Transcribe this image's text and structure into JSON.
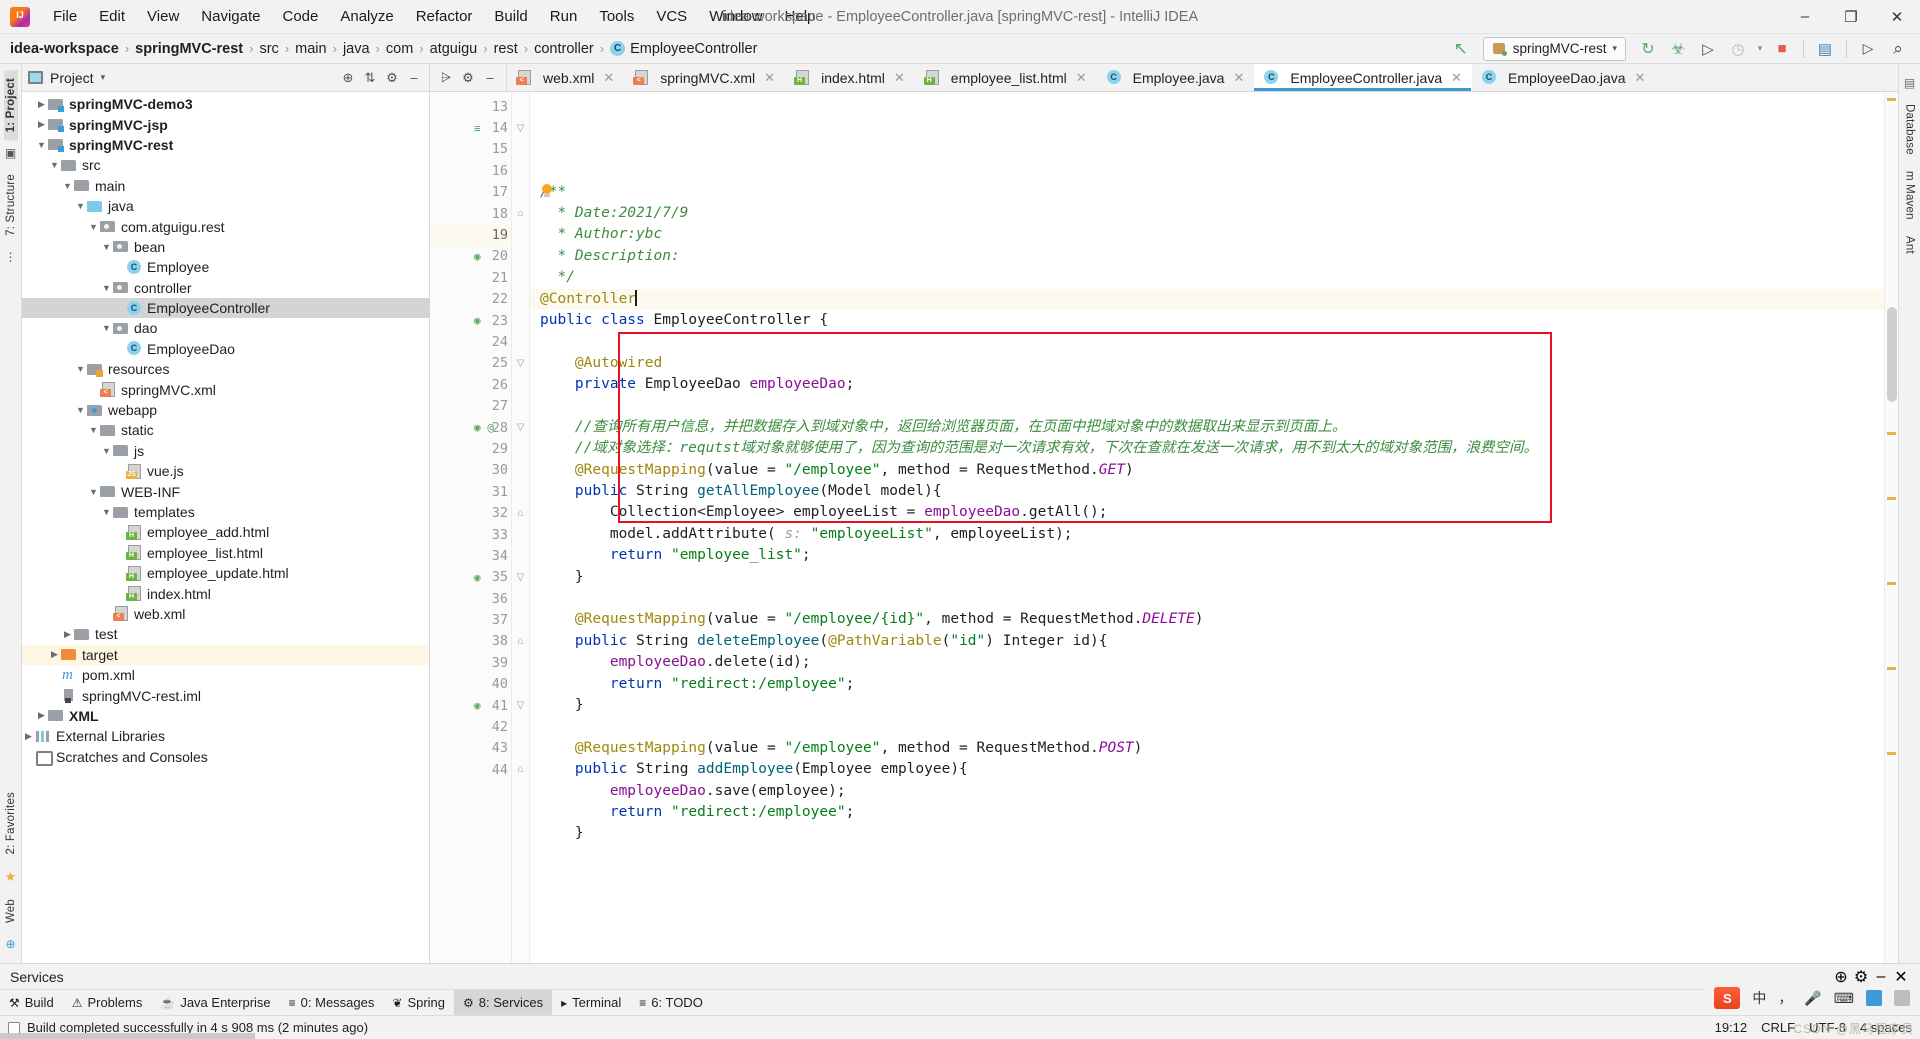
{
  "window": {
    "title": "idea-workspace - EmployeeController.java [springMVC-rest] - IntelliJ IDEA",
    "minimize": "–",
    "maximize": "❐",
    "close": "✕"
  },
  "menu": {
    "items": [
      "File",
      "Edit",
      "View",
      "Navigate",
      "Code",
      "Analyze",
      "Refactor",
      "Build",
      "Run",
      "Tools",
      "VCS",
      "Window",
      "Help"
    ]
  },
  "breadcrumb": {
    "items": [
      "idea-workspace",
      "springMVC-rest",
      "src",
      "main",
      "java",
      "com",
      "atguigu",
      "rest",
      "controller"
    ],
    "class_item": "EmployeeController",
    "separator": "›"
  },
  "toolbar": {
    "build_hammer": "↖",
    "run_config": "springMVC-rest",
    "run_config_caret": "▾",
    "rerun": "↻",
    "debug": "☣",
    "coverage": "▷",
    "profile": "◷",
    "profile_caret": "▾",
    "stop": "■",
    "project_structure": "▤",
    "device_manager": "▷",
    "search_everywhere": "⌕"
  },
  "project_panel": {
    "title": "Project",
    "caret": "▾",
    "actions": [
      "⊕",
      "⇅",
      "⚙",
      "–"
    ],
    "tree": [
      {
        "label": "springMVC-demo3",
        "depth": 1,
        "twisty": "▶",
        "icon": "mod",
        "bold": true
      },
      {
        "label": "springMVC-jsp",
        "depth": 1,
        "twisty": "▶",
        "icon": "mod",
        "bold": true
      },
      {
        "label": "springMVC-rest",
        "depth": 1,
        "twisty": "▼",
        "icon": "mod",
        "bold": true
      },
      {
        "label": "src",
        "depth": 2,
        "twisty": "▼",
        "icon": "fold",
        "bold": false
      },
      {
        "label": "main",
        "depth": 3,
        "twisty": "▼",
        "icon": "fold",
        "bold": false
      },
      {
        "label": "java",
        "depth": 4,
        "twisty": "▼",
        "icon": "src",
        "bold": false
      },
      {
        "label": "com.atguigu.rest",
        "depth": 5,
        "twisty": "▼",
        "icon": "pkg",
        "bold": false
      },
      {
        "label": "bean",
        "depth": 6,
        "twisty": "▼",
        "icon": "pkg",
        "bold": false
      },
      {
        "label": "Employee",
        "depth": 7,
        "twisty": "",
        "icon": "cls",
        "bold": false
      },
      {
        "label": "controller",
        "depth": 6,
        "twisty": "▼",
        "icon": "pkg",
        "bold": false
      },
      {
        "label": "EmployeeController",
        "depth": 7,
        "twisty": "",
        "icon": "cls",
        "bold": false,
        "selected": true
      },
      {
        "label": "dao",
        "depth": 6,
        "twisty": "▼",
        "icon": "pkg",
        "bold": false
      },
      {
        "label": "EmployeeDao",
        "depth": 7,
        "twisty": "",
        "icon": "cls",
        "bold": false
      },
      {
        "label": "resources",
        "depth": 4,
        "twisty": "▼",
        "icon": "res",
        "bold": false
      },
      {
        "label": "springMVC.xml",
        "depth": 5,
        "twisty": "",
        "icon": "xml",
        "bold": false
      },
      {
        "label": "webapp",
        "depth": 4,
        "twisty": "▼",
        "icon": "web",
        "bold": false
      },
      {
        "label": "static",
        "depth": 5,
        "twisty": "▼",
        "icon": "fold",
        "bold": false
      },
      {
        "label": "js",
        "depth": 6,
        "twisty": "▼",
        "icon": "fold",
        "bold": false
      },
      {
        "label": "vue.js",
        "depth": 7,
        "twisty": "",
        "icon": "js",
        "bold": false
      },
      {
        "label": "WEB-INF",
        "depth": 5,
        "twisty": "▼",
        "icon": "fold",
        "bold": false
      },
      {
        "label": "templates",
        "depth": 6,
        "twisty": "▼",
        "icon": "fold",
        "bold": false
      },
      {
        "label": "employee_add.html",
        "depth": 7,
        "twisty": "",
        "icon": "html",
        "bold": false
      },
      {
        "label": "employee_list.html",
        "depth": 7,
        "twisty": "",
        "icon": "html",
        "bold": false
      },
      {
        "label": "employee_update.html",
        "depth": 7,
        "twisty": "",
        "icon": "html",
        "bold": false
      },
      {
        "label": "index.html",
        "depth": 7,
        "twisty": "",
        "icon": "html",
        "bold": false
      },
      {
        "label": "web.xml",
        "depth": 6,
        "twisty": "",
        "icon": "xml",
        "bold": false
      },
      {
        "label": "test",
        "depth": 3,
        "twisty": "▶",
        "icon": "fold",
        "bold": false
      },
      {
        "label": "target",
        "depth": 2,
        "twisty": "▶",
        "icon": "tgt",
        "bold": false,
        "highlight": true
      },
      {
        "label": "pom.xml",
        "depth": 2,
        "twisty": "",
        "icon": "maven",
        "bold": false
      },
      {
        "label": "springMVC-rest.iml",
        "depth": 2,
        "twisty": "",
        "icon": "iml",
        "bold": false
      },
      {
        "label": "XML",
        "depth": 1,
        "twisty": "▶",
        "icon": "xmlgrp",
        "bold": true
      },
      {
        "label": "External Libraries",
        "depth": 0,
        "twisty": "▶",
        "icon": "lib",
        "bold": false
      },
      {
        "label": "Scratches and Consoles",
        "depth": 0,
        "twisty": "",
        "icon": "scratch",
        "bold": false
      }
    ]
  },
  "left_rail": {
    "tabs": [
      "1: Project",
      "7: Structure"
    ],
    "bottom_tabs": [
      "2: Favorites",
      "Web"
    ]
  },
  "right_rail": {
    "tabs": [
      "Database",
      "m Maven",
      "Ant"
    ]
  },
  "editor_tabs": [
    {
      "label": "web.xml",
      "icon": "xml",
      "active": false,
      "close": "✕"
    },
    {
      "label": "springMVC.xml",
      "icon": "xml",
      "active": false,
      "close": "✕"
    },
    {
      "label": "index.html",
      "icon": "html",
      "active": false,
      "close": "✕"
    },
    {
      "label": "employee_list.html",
      "icon": "html",
      "active": false,
      "close": "✕"
    },
    {
      "label": "Employee.java",
      "icon": "java",
      "active": false,
      "close": "✕"
    },
    {
      "label": "EmployeeController.java",
      "icon": "java",
      "active": true,
      "close": "✕"
    },
    {
      "label": "EmployeeDao.java",
      "icon": "java",
      "active": false,
      "close": "✕"
    }
  ],
  "editor_tab_actions": {
    "collapse": "⩥",
    "settings": "⚙",
    "hide": "–"
  },
  "code": {
    "first_line": 13,
    "current_line": 19,
    "lines": [
      {
        "n": 13,
        "html": ""
      },
      {
        "n": 14,
        "html": "<span class='doc'>/**</span>",
        "mark": "≡",
        "fold": "▽"
      },
      {
        "n": 15,
        "html": "  <span class='doc'>* Date:2021/7/9</span>"
      },
      {
        "n": 16,
        "html": "  <span class='doc'>* Author:ybc</span>"
      },
      {
        "n": 17,
        "html": "  <span class='doc'>* Description:</span>"
      },
      {
        "n": 18,
        "html": "  <span class='doc'>*/</span>",
        "fold": "⌂",
        "bulb": true
      },
      {
        "n": 19,
        "html": "<span class='ann'>@Controller</span><span class='caret-bar'></span>",
        "current": true
      },
      {
        "n": 20,
        "html": "<span class='kw'>public class</span> EmployeeController {",
        "mark": "◉"
      },
      {
        "n": 21,
        "html": ""
      },
      {
        "n": 22,
        "html": "    <span class='ann'>@Autowired</span>"
      },
      {
        "n": 23,
        "html": "    <span class='kw'>private</span> EmployeeDao <span class='fld'>employeeDao</span>;",
        "mark": "◉"
      },
      {
        "n": 24,
        "html": ""
      },
      {
        "n": 25,
        "html": "    <span class='cmt-zh'>//查询所有用户信息，并把数据存入到域对象中，返回给浏览器页面，在页面中把域对象中的数据取出来显示到页面上。</span>",
        "fold": "▽"
      },
      {
        "n": 26,
        "html": "    <span class='cmt-zh'>//域对象选择：requtst域对象就够使用了，因为查询的范围是对一次请求有效，下次在查就在发送一次请求，用不到太大的域对象范围，浪费空间。</span>"
      },
      {
        "n": 27,
        "html": "    <span class='ann'>@RequestMapping</span>(value = <span class='str'>\"/employee\"</span>, method = RequestMethod.<span class='sta'>GET</span>)"
      },
      {
        "n": 28,
        "html": "    <span class='kw'>public</span> String <span class='mth'>getAllEmployee</span>(Model model){",
        "mark": "◉ @",
        "fold": "▽"
      },
      {
        "n": 29,
        "html": "        Collection&lt;Employee&gt; employeeList = <span class='fld'>employeeDao</span>.getAll();"
      },
      {
        "n": 30,
        "html": "        model.addAttribute( <span class='param-hint'>s:</span> <span class='str'>\"employeeList\"</span>, employeeList);"
      },
      {
        "n": 31,
        "html": "        <span class='kw'>return</span> <span class='str'>\"employee_list\"</span>;"
      },
      {
        "n": 32,
        "html": "    }",
        "fold": "⌂"
      },
      {
        "n": 33,
        "html": ""
      },
      {
        "n": 34,
        "html": "    <span class='ann'>@RequestMapping</span>(value = <span class='str'>\"/employee/{id}\"</span>, method = RequestMethod.<span class='sta'>DELETE</span>)"
      },
      {
        "n": 35,
        "html": "    <span class='kw'>public</span> String <span class='mth'>deleteEmployee</span>(<span class='ann'>@PathVariable</span>(<span class='str'>\"id\"</span>) Integer id){",
        "mark": "◉",
        "fold": "▽"
      },
      {
        "n": 36,
        "html": "        <span class='fld'>employeeDao</span>.delete(id);"
      },
      {
        "n": 37,
        "html": "        <span class='kw'>return</span> <span class='str'>\"redirect:/employee\"</span>;"
      },
      {
        "n": 38,
        "html": "    }",
        "fold": "⌂"
      },
      {
        "n": 39,
        "html": ""
      },
      {
        "n": 40,
        "html": "    <span class='ann'>@RequestMapping</span>(value = <span class='str'>\"/employee\"</span>, method = RequestMethod.<span class='sta'>POST</span>)"
      },
      {
        "n": 41,
        "html": "    <span class='kw'>public</span> String <span class='mth'>addEmployee</span>(Employee employee){",
        "mark": "◉",
        "fold": "▽"
      },
      {
        "n": 42,
        "html": "        <span class='fld'>employeeDao</span>.save(employee);"
      },
      {
        "n": 43,
        "html": "        <span class='kw'>return</span> <span class='str'>\"redirect:/employee\"</span>;"
      },
      {
        "n": 44,
        "html": "    }",
        "fold": "⌂"
      }
    ]
  },
  "services": {
    "title": "Services",
    "actions": [
      "⊕",
      "⚙",
      "–",
      "✕"
    ]
  },
  "tool_windows": [
    {
      "label": "Build",
      "icon": "⚒",
      "active": false
    },
    {
      "label": "Problems",
      "icon": "⚠",
      "active": false
    },
    {
      "label": "Java Enterprise",
      "icon": "☕",
      "active": false
    },
    {
      "label": "0: Messages",
      "icon": "≡",
      "active": false
    },
    {
      "label": "Spring",
      "icon": "❦",
      "active": false
    },
    {
      "label": "8: Services",
      "icon": "⚙",
      "active": true
    },
    {
      "label": "Terminal",
      "icon": "▸",
      "active": false
    },
    {
      "label": "6: TODO",
      "icon": "≡",
      "active": false
    }
  ],
  "status": {
    "message": "Build completed successfully in 4 s 908 ms (2 minutes ago)",
    "time": "19:12",
    "line_sep": "CRLF",
    "encoding": "UTF-8",
    "indent": "4 spaces"
  },
  "tray": {
    "lang": "中",
    "comma": "，",
    "mic": "ᴘ",
    "keyboard": "⌨",
    "more": "⋯"
  },
  "watermark": "CSDN @黑马程序员",
  "colors": {
    "accent": "#3d9ad6",
    "redbox": "#e81123",
    "keyword": "#0033b3",
    "string": "#067d17",
    "annotation": "#9e880d",
    "comment": "#3d8c40"
  }
}
